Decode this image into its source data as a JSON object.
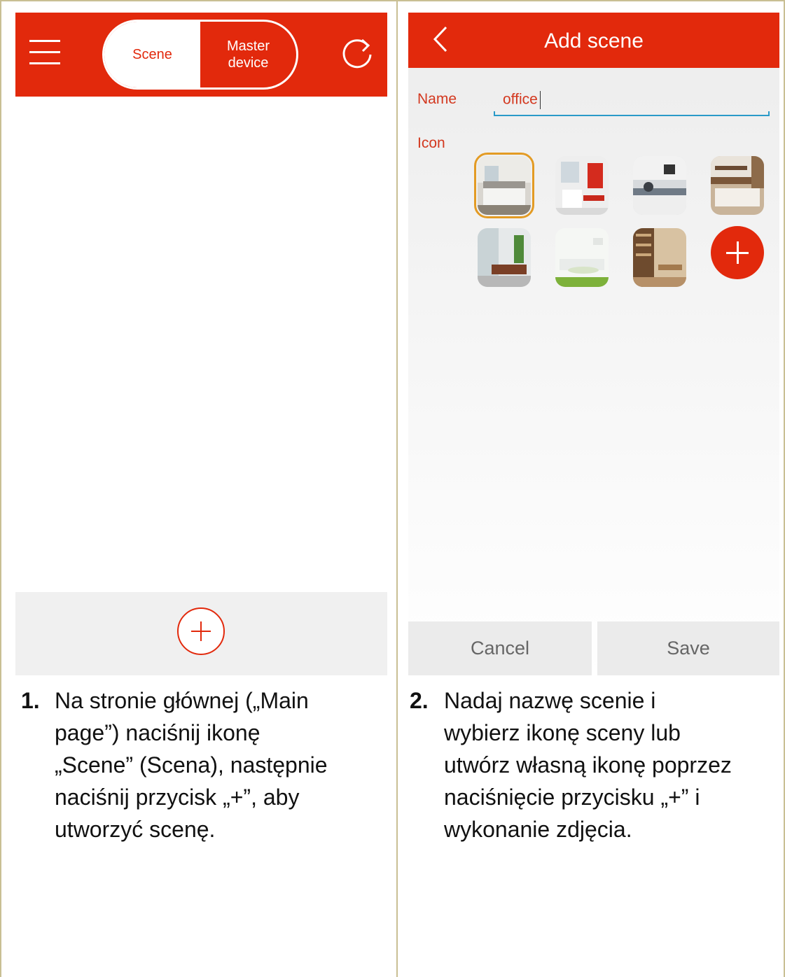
{
  "left": {
    "toggle": {
      "scene": "Scene",
      "master": "Master\ndevice"
    }
  },
  "right": {
    "title": "Add scene",
    "name_label": "Name",
    "name_value": "office",
    "icon_label": "Icon",
    "cancel": "Cancel",
    "save": "Save"
  },
  "captions": [
    {
      "number": "1.",
      "text": "Na stronie głównej („Main\npage”) naciśnij ikonę\n„Scene” (Scena), następnie\nnaciśnij przycisk „+”, aby\nutworzyć scenę."
    },
    {
      "number": "2.",
      "text": "Nadaj nazwę scenie i\nwybierz ikonę sceny lub\nutwórz własną ikonę poprzez\nnaciśnięcie przycisku „+” i\nwykonanie zdjęcia."
    }
  ],
  "colors": {
    "accent": "#e2290c",
    "border": "#c9bf94",
    "focus": "#2a9ac8",
    "selection": "#e39b24"
  }
}
